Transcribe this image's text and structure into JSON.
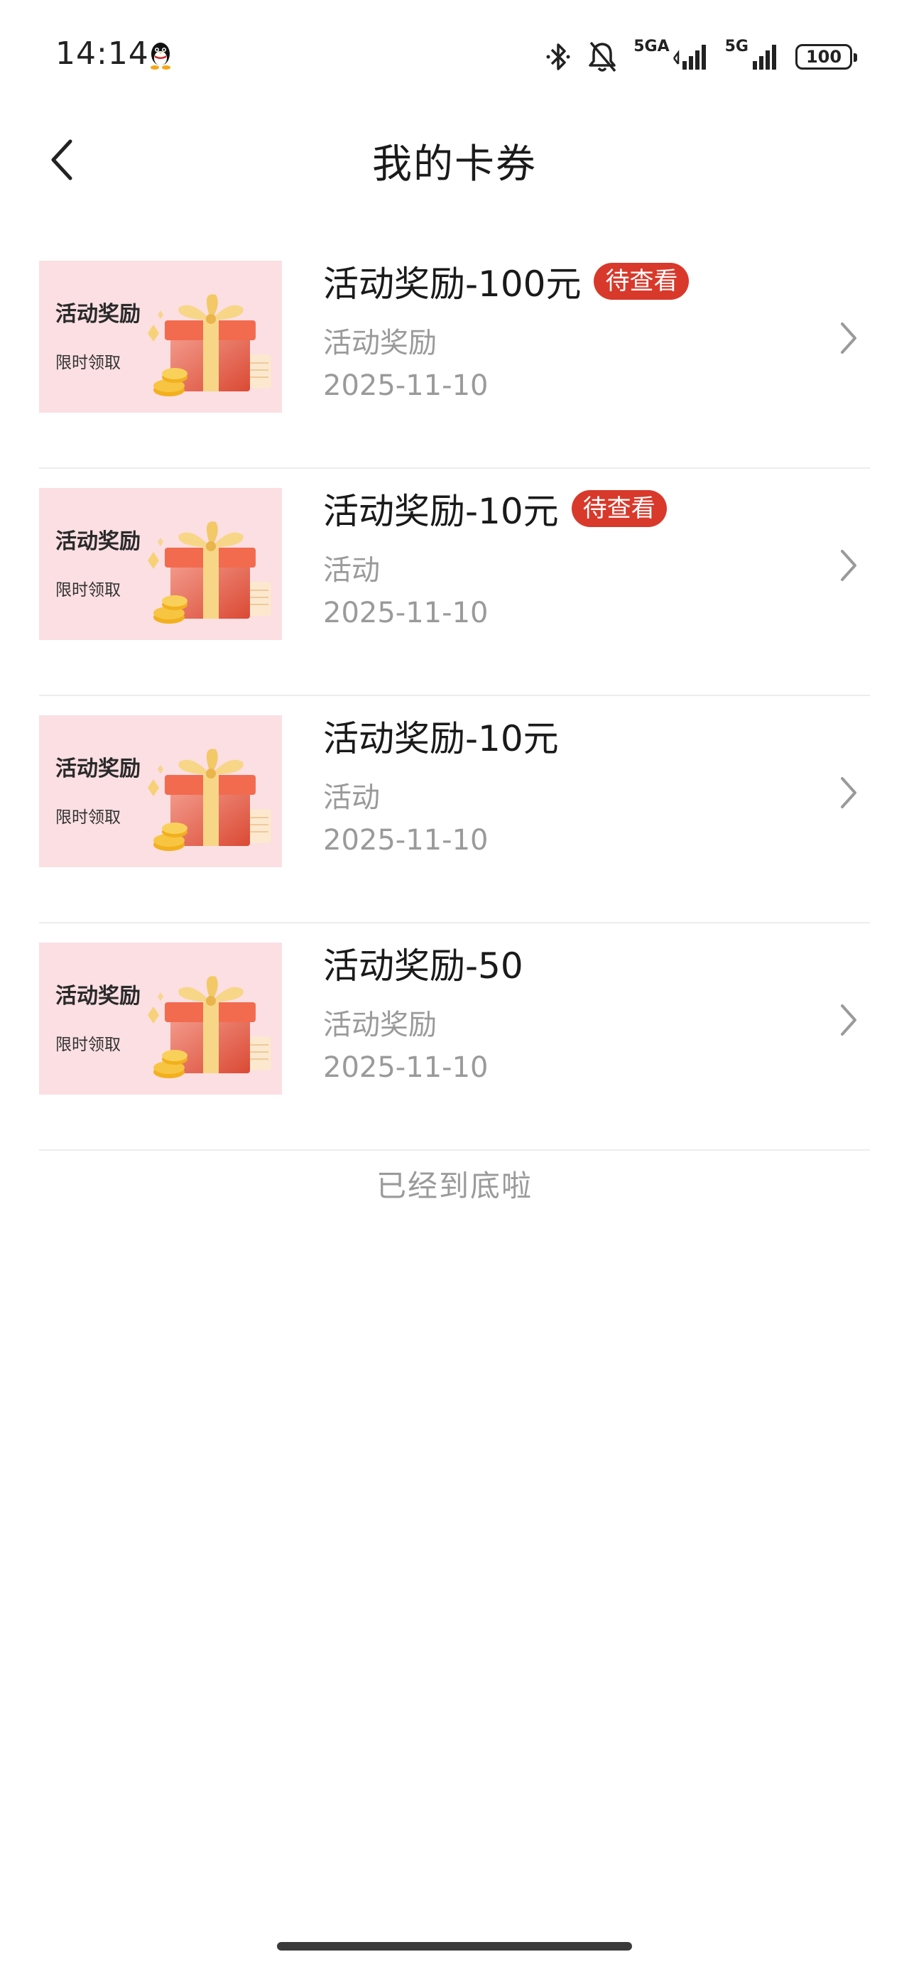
{
  "status_bar": {
    "time": "14:14",
    "network_1": "5GA",
    "network_2": "5G",
    "battery": "100",
    "icons": [
      "qq-icon",
      "bluetooth-icon",
      "bell-muted-icon",
      "signal-icon",
      "battery-icon"
    ]
  },
  "header": {
    "title": "我的卡券",
    "back_icon": "chevron-left-icon"
  },
  "coupons": [
    {
      "thumb_title": "活动奖励",
      "thumb_sub": "限时领取",
      "title": "活动奖励-100元",
      "badge": "待查看",
      "desc": "活动奖励",
      "date": "2025-11-10"
    },
    {
      "thumb_title": "活动奖励",
      "thumb_sub": "限时领取",
      "title": "活动奖励-10元",
      "badge": "待查看",
      "desc": "活动",
      "date": "2025-11-10"
    },
    {
      "thumb_title": "活动奖励",
      "thumb_sub": "限时领取",
      "title": "活动奖励-10元",
      "badge": null,
      "desc": "活动",
      "date": "2025-11-10"
    },
    {
      "thumb_title": "活动奖励",
      "thumb_sub": "限时领取",
      "title": "活动奖励-50",
      "badge": null,
      "desc": "活动奖励",
      "date": "2025-11-10"
    }
  ],
  "end_text": "已经到底啦",
  "colors": {
    "badge": "#d8392b",
    "thumb_bg": "#fbdfe3",
    "muted_text": "#9a9a9a",
    "divider": "#ececec"
  }
}
